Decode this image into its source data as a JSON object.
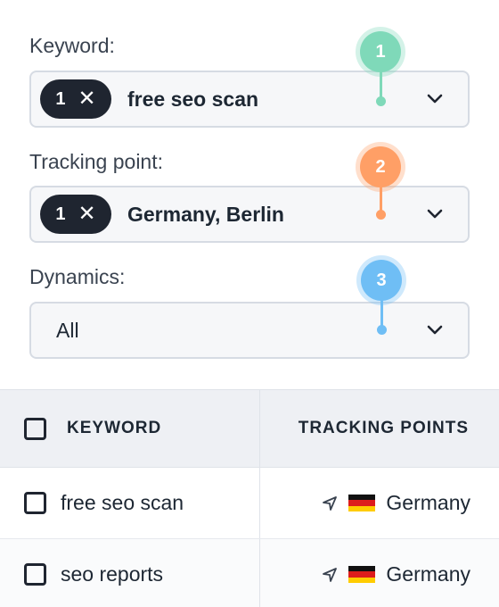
{
  "filters": {
    "keyword": {
      "label": "Keyword:",
      "count": "1",
      "value": "free seo scan"
    },
    "tracking_point": {
      "label": "Tracking point:",
      "count": "1",
      "value": "Germany, Berlin"
    },
    "dynamics": {
      "label": "Dynamics:",
      "value": "All"
    }
  },
  "markers": [
    {
      "number": "1",
      "color": "#7fd9b9"
    },
    {
      "number": "2",
      "color": "#ff9f66"
    },
    {
      "number": "3",
      "color": "#6fbef5"
    }
  ],
  "table": {
    "columns": [
      "KEYWORD",
      "TRACKING POINTS"
    ],
    "rows": [
      {
        "keyword": "free seo scan",
        "tracking_point": "Germany"
      },
      {
        "keyword": "seo reports",
        "tracking_point": "Germany"
      }
    ]
  },
  "icons": {
    "remove": "close-icon",
    "dropdown": "chevron-down-icon",
    "location": "navigation-arrow-icon",
    "flag": "germany-flag-icon"
  },
  "colors": {
    "chip": "#1f2530",
    "select_bg": "#f6f7f9",
    "header_bg": "#eef0f4"
  }
}
